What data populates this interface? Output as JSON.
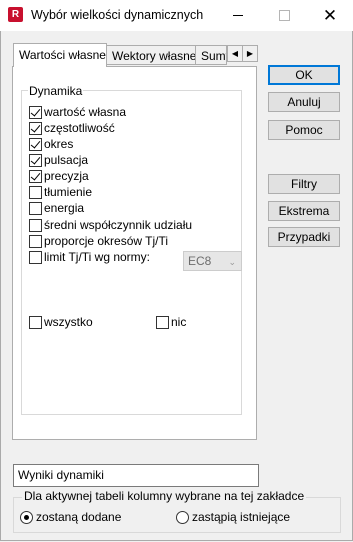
{
  "window": {
    "title": "Wybór wielkości dynamicznych",
    "app_icon_letter": "R",
    "close_symbol": "✕"
  },
  "tabs": [
    {
      "label": "Wartości własne",
      "active": true
    },
    {
      "label": "Wektory własne",
      "active": false
    },
    {
      "label": "Sumy",
      "active": false
    }
  ],
  "tab_scroll": {
    "left": "◀",
    "right": "▶"
  },
  "dynamics": {
    "group_title": "Dynamika",
    "items": [
      {
        "label": "wartość własna",
        "checked": true
      },
      {
        "label": "częstotliwość",
        "checked": true
      },
      {
        "label": "okres",
        "checked": true
      },
      {
        "label": "pulsacja",
        "checked": true
      },
      {
        "label": "precyzja",
        "checked": true
      },
      {
        "label": "tłumienie",
        "checked": false
      },
      {
        "label": "energia",
        "checked": false
      },
      {
        "label": "średni współczynnik udziału",
        "checked": false
      },
      {
        "label": "proporcje okresów Tj/Ti",
        "checked": false
      },
      {
        "label": "limit Tj/Ti wg normy:",
        "checked": false
      }
    ],
    "norm_select": {
      "value": "EC8",
      "arrow": "⌄"
    },
    "select_all": {
      "label": "wszystko",
      "checked": false
    },
    "select_none": {
      "label": "nic",
      "checked": false
    }
  },
  "buttons": {
    "ok": "OK",
    "cancel": "Anuluj",
    "help": "Pomoc",
    "filters": "Filtry",
    "extremes": "Ekstrema",
    "cases": "Przypadki"
  },
  "table_name": {
    "value": "Wyniki dynamiki"
  },
  "columns_group": {
    "title": "Dla aktywnej tabeli kolumny wybrane na tej zakładce",
    "options": [
      {
        "label": "zostaną dodane",
        "selected": true
      },
      {
        "label": "zastąpią istniejące",
        "selected": false
      }
    ]
  }
}
